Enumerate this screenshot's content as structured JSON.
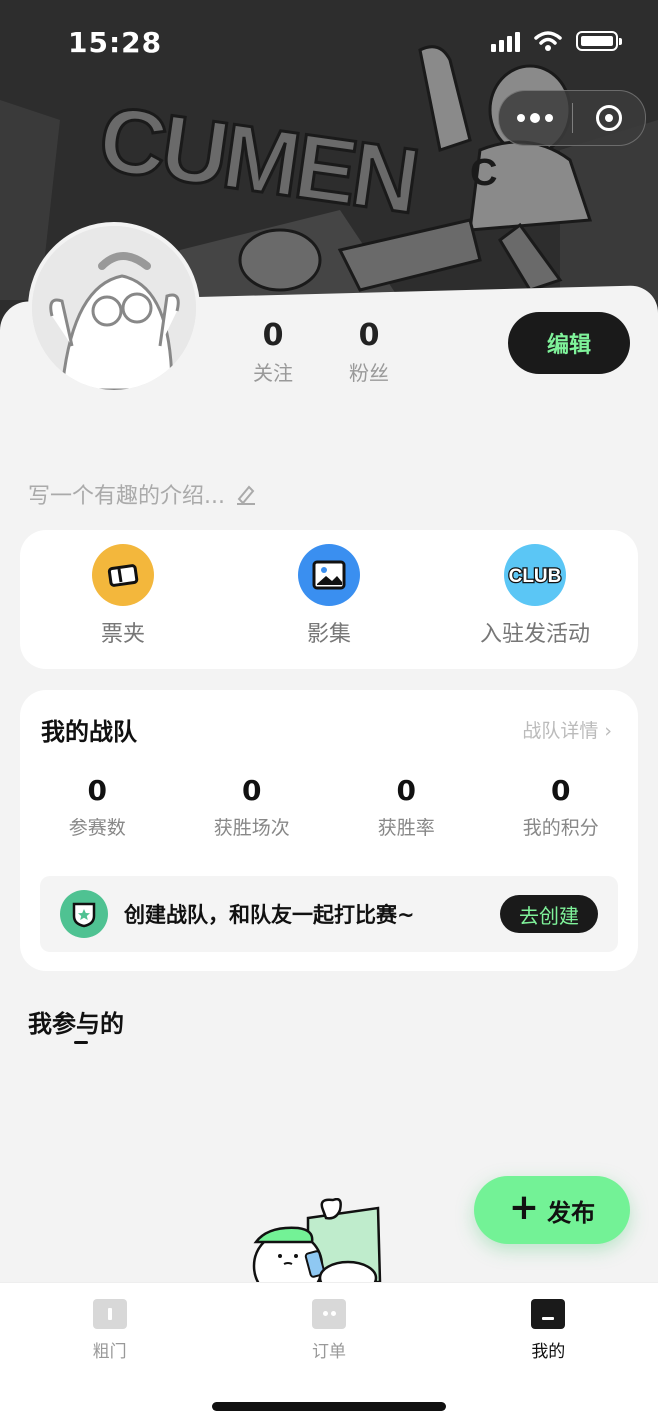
{
  "status_bar": {
    "time": "15:28"
  },
  "hero": {
    "brand_text": "CUMEN",
    "badge_letter": "C"
  },
  "profile": {
    "following_count": "0",
    "following_label": "关注",
    "followers_count": "0",
    "followers_label": "粉丝",
    "edit_label": "编辑",
    "intro_placeholder": "写一个有趣的介绍..."
  },
  "quick_actions": [
    {
      "label": "票夹",
      "icon": "ticket-icon",
      "color": "#f3b73c"
    },
    {
      "label": "影集",
      "icon": "album-icon",
      "color": "#3a8ff0"
    },
    {
      "label": "入驻发活动",
      "icon": "club-icon",
      "color": "#5bc6f5",
      "icon_text": "CLUB"
    }
  ],
  "team": {
    "title": "我的战队",
    "detail_link": "战队详情",
    "metrics": [
      {
        "value": "0",
        "label": "参赛数"
      },
      {
        "value": "0",
        "label": "获胜场次"
      },
      {
        "value": "0",
        "label": "获胜率"
      },
      {
        "value": "0",
        "label": "我的积分"
      }
    ],
    "create_prompt": "创建战队，和队友一起打比赛~",
    "create_button": "去创建"
  },
  "participated": {
    "title": "我参与的"
  },
  "fab": {
    "label": "发布"
  },
  "tabbar": {
    "items": [
      {
        "label": "粗门",
        "icon": "home-icon",
        "active": false
      },
      {
        "label": "订单",
        "icon": "order-icon",
        "active": false
      },
      {
        "label": "我的",
        "icon": "profile-icon",
        "active": true
      }
    ]
  },
  "colors": {
    "accent_green": "#73f296",
    "dark": "#1a1a1a",
    "hero_bg": "#2b2b2b"
  }
}
